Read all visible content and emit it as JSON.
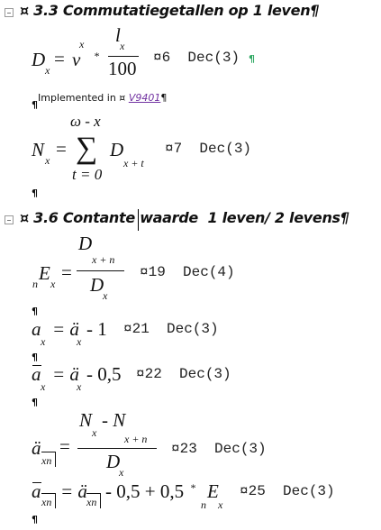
{
  "section1": {
    "heading": "¤ 3.3 Commutatiegetallen op 1 leven¶",
    "formula_D": {
      "lhs": "D",
      "lhs_sub": "x",
      "eq": "=",
      "base": "v",
      "sup": "x",
      "times": "*",
      "num": "l",
      "num_sub": "x",
      "den": "100",
      "tag": "¤6  Dec(3)",
      "pilcrow": "¶"
    },
    "implemented": {
      "label": "Implemented in ¤ ",
      "link": "V9401",
      "pilcrow": "¶"
    },
    "pilcrow1": "¶",
    "formula_N": {
      "lhs": "N",
      "lhs_sub": "x",
      "eq": "=",
      "sum": "∑",
      "upper": "ω - x",
      "lower": "t = 0",
      "term": "D",
      "term_sub": "x + t",
      "tag": "¤7  Dec(3)"
    },
    "pilcrow2": "¶"
  },
  "section2": {
    "heading": "¤ 3.6 Contante waarde  1 leven/ 2 levens¶",
    "formula_E": {
      "pre_sub": "n",
      "lhs": "E",
      "lhs_sub": "x",
      "eq": "=",
      "num": "D",
      "num_sub": "x + n",
      "den": "D",
      "den_sub": "x",
      "tag": "¤19  Dec(4)"
    },
    "pilcrow1": "¶",
    "formula_a": {
      "lhs": "a",
      "lhs_sub": "x",
      "rhs": "= ä",
      "rhs_sub": "x",
      "tail": "- 1",
      "tag": "¤21  Dec(3)"
    },
    "pilcrow2": "¶",
    "formula_abar": {
      "lhs": "a",
      "lhs_sub": "x",
      "rhs": "= ä",
      "rhs_sub": "x",
      "tail": "- 0,5",
      "tag": "¤22  Dec(3)"
    },
    "pilcrow3": "¶",
    "formula_adn": {
      "lhs": "ä",
      "lhs_sub": "xn",
      "eq": "=",
      "num_a": "N",
      "num_a_sub": "x",
      "num_op": "- N",
      "num_b_sub": "x + n",
      "den": "D",
      "den_sub": "x",
      "tag": "¤23  Dec(3)"
    },
    "formula_abarn": {
      "lhs": "a",
      "lhs_sub": "xn",
      "rhs": "= ä",
      "rhs_sub": "xn",
      "tail": "- 0,5 + 0,5",
      "times": "*",
      "pre_sub": "n",
      "E": "E",
      "E_sub": "x",
      "tag": "¤25  Dec(3)"
    },
    "pilcrow4": "¶"
  }
}
